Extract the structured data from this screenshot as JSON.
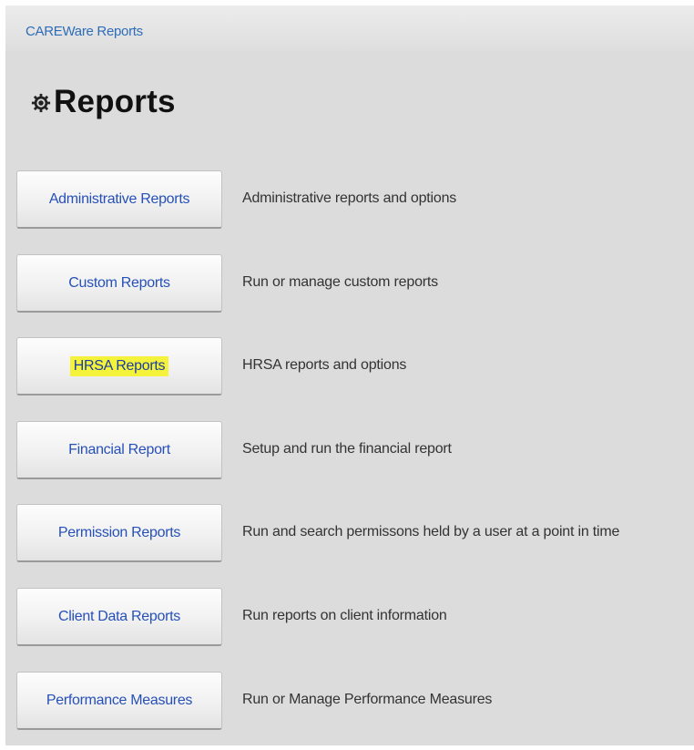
{
  "header": {
    "breadcrumb": "CAREWare Reports"
  },
  "page": {
    "title": "Reports",
    "title_icon": "gear-icon"
  },
  "highlight_color": "#f4f23a",
  "link_color": "#2650b8",
  "reports": [
    {
      "button_label": "Administrative Reports",
      "description": "Administrative reports and options"
    },
    {
      "button_label": "Custom Reports",
      "description": "Run or manage custom reports"
    },
    {
      "button_label": "HRSA Reports",
      "description": "HRSA reports and options",
      "highlighted": true
    },
    {
      "button_label": "Financial Report",
      "description": "Setup and run the financial report"
    },
    {
      "button_label": "Permission Reports",
      "description": "Run and search permissons held by a user at a point in time"
    },
    {
      "button_label": "Client Data Reports",
      "description": "Run reports on client information"
    },
    {
      "button_label": "Performance Measures",
      "description": "Run or Manage Performance Measures"
    }
  ]
}
